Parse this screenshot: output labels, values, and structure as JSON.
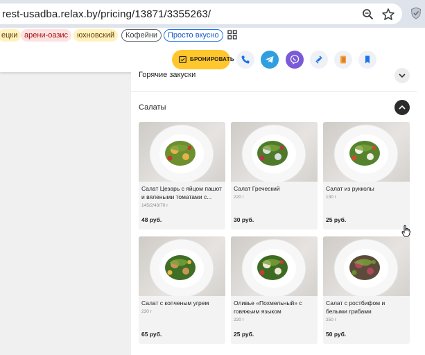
{
  "browser": {
    "url": "rest-usadba.relax.by/pricing/13871/3355263/",
    "icons": {
      "zoom": "zoom-icon",
      "star": "star-icon",
      "shield": "shield-icon"
    }
  },
  "bookmarks": [
    {
      "label": "ецки",
      "style": "yellow"
    },
    {
      "label": "арени-оазис",
      "style": "red"
    },
    {
      "label": "юхновский",
      "style": "yellow"
    },
    {
      "label": "Кофейни",
      "style": "grey"
    },
    {
      "label": "Просто вкусно",
      "style": "blue"
    }
  ],
  "toolbar": {
    "book_label": "БРОНИРОВАТЬ",
    "buttons": [
      "phone-icon",
      "telegram-icon",
      "viber-icon",
      "link-icon",
      "menu-book-icon",
      "bookmark-icon"
    ],
    "colors": {
      "book": "#ffc72c",
      "telegram": "#2f9fe0",
      "viber": "#7a5ad6",
      "accent": "#1a73e8"
    }
  },
  "sections": {
    "hot_snacks": "Горячие закуски",
    "salads": "Салаты"
  },
  "dishes": [
    {
      "title": "Салат Цезарь с яйцом пашот и вялеными томатами с...",
      "weight": "145/2/43/70 г",
      "price": "48 руб."
    },
    {
      "title": "Салат Греческий",
      "weight": "220 г",
      "price": "30 руб."
    },
    {
      "title": "Салат из рукколы",
      "weight": "130 г",
      "price": "25 руб."
    },
    {
      "title": "Салат с копченым угрем",
      "weight": "230 г",
      "price": "65 руб."
    },
    {
      "title": "Оливье «Похмельный» с говяжьим языком",
      "weight": "220 г",
      "price": "25 руб."
    },
    {
      "title": "Салат с ростбифом и белыми грибами",
      "weight": "250 г",
      "price": "50 руб."
    }
  ]
}
